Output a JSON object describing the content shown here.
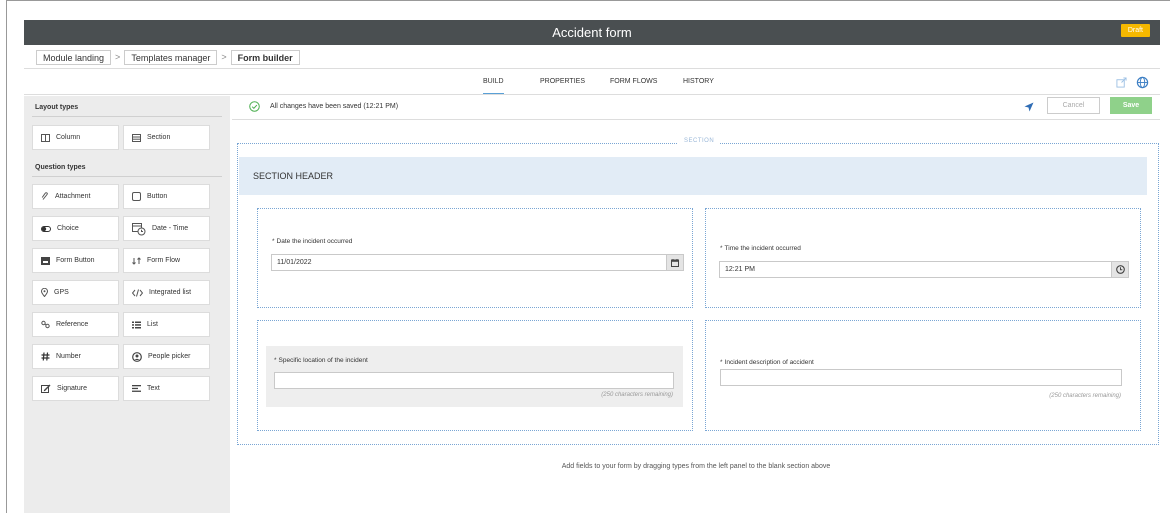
{
  "app": {
    "title": "Accident form",
    "status_badge": "Draft",
    "accent_color": "#f5b800",
    "header_color": "#4a4f51"
  },
  "breadcrumbs": [
    {
      "label": "Module landing"
    },
    {
      "label": "Templates manager"
    },
    {
      "label": "Form builder"
    }
  ],
  "tabs": [
    {
      "label": "BUILD",
      "active": true
    },
    {
      "label": "PROPERTIES",
      "active": false
    },
    {
      "label": "FORM FLOWS",
      "active": false
    },
    {
      "label": "HISTORY",
      "active": false
    }
  ],
  "left_panel": {
    "layout_title": "Layout types",
    "layout_items": [
      {
        "label": "Column",
        "icon": "column-icon"
      },
      {
        "label": "Section",
        "icon": "section-icon"
      }
    ],
    "question_title": "Question types",
    "question_items": [
      {
        "label": "Attachment",
        "icon": "paperclip-icon"
      },
      {
        "label": "Button",
        "icon": "button-icon"
      },
      {
        "label": "Choice",
        "icon": "toggle-icon"
      },
      {
        "label": "Date - Time",
        "icon": "calendar-clock-icon"
      },
      {
        "label": "Form Button",
        "icon": "form-button-icon"
      },
      {
        "label": "Form Flow",
        "icon": "form-flow-icon"
      },
      {
        "label": "GPS",
        "icon": "location-pin-icon"
      },
      {
        "label": "Integrated list",
        "icon": "code-icon"
      },
      {
        "label": "Reference",
        "icon": "reference-icon"
      },
      {
        "label": "List",
        "icon": "list-icon"
      },
      {
        "label": "Number",
        "icon": "hash-icon"
      },
      {
        "label": "People picker",
        "icon": "person-icon"
      },
      {
        "label": "Signature",
        "icon": "signature-icon"
      },
      {
        "label": "Text",
        "icon": "text-icon"
      }
    ]
  },
  "savebar": {
    "message": "All changes have been saved (12:21 PM)",
    "cancel_label": "Cancel",
    "save_label": "Save",
    "save_color": "#8fd18a"
  },
  "section": {
    "tag": "SECTION",
    "header": "SECTION HEADER",
    "fields": [
      {
        "label": "Date the incident occurred",
        "value": "11/01/2022",
        "required": "*"
      },
      {
        "label": "Time the incident occurred",
        "value": "12:21 PM",
        "required": "*"
      },
      {
        "label": "Specific location of the incident",
        "value": "",
        "required": "*",
        "remaining": "(250 characters remaining)"
      },
      {
        "label": "Incident description of accident",
        "value": "",
        "required": "*",
        "remaining": "(250 characters remaining)"
      }
    ]
  },
  "hint": "Add fields to your form by dragging types from the left panel to the blank section above"
}
